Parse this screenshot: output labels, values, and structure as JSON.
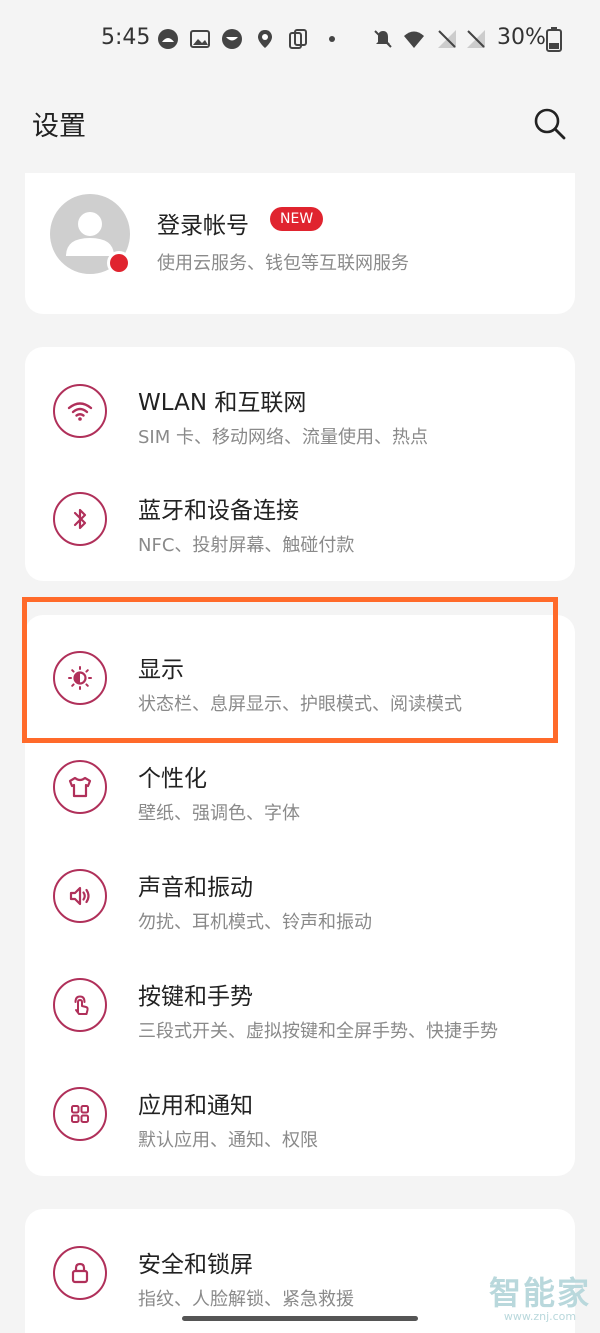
{
  "status_bar": {
    "time": "5:45",
    "battery": "30%"
  },
  "header": {
    "title": "设置"
  },
  "account": {
    "title": "登录帐号",
    "badge": "NEW",
    "subtitle": "使用云服务、钱包等互联网服务"
  },
  "groups": [
    {
      "items": [
        {
          "title": "WLAN 和互联网",
          "subtitle": "SIM 卡、移动网络、流量使用、热点",
          "icon": "wifi-icon"
        },
        {
          "title": "蓝牙和设备连接",
          "subtitle": "NFC、投射屏幕、触碰付款",
          "icon": "bluetooth-icon"
        }
      ]
    },
    {
      "items": [
        {
          "title": "显示",
          "subtitle": "状态栏、息屏显示、护眼模式、阅读模式",
          "icon": "brightness-icon"
        },
        {
          "title": "个性化",
          "subtitle": "壁纸、强调色、字体",
          "icon": "tshirt-icon"
        },
        {
          "title": "声音和振动",
          "subtitle": "勿扰、耳机模式、铃声和振动",
          "icon": "speaker-icon"
        },
        {
          "title": "按键和手势",
          "subtitle": "三段式开关、虚拟按键和全屏手势、快捷手势",
          "icon": "gesture-icon"
        },
        {
          "title": "应用和通知",
          "subtitle": "默认应用、通知、权限",
          "icon": "apps-grid-icon"
        }
      ]
    },
    {
      "items": [
        {
          "title": "安全和锁屏",
          "subtitle": "指纹、人脸解锁、紧急救援",
          "icon": "lock-icon"
        }
      ]
    }
  ],
  "watermark": {
    "logo": "智能家",
    "url": "www.znj.com"
  },
  "colors": {
    "accent": "#b0305a",
    "badge": "#e0242f",
    "highlight": "#ff6a2a",
    "background": "#f4f4f4"
  }
}
